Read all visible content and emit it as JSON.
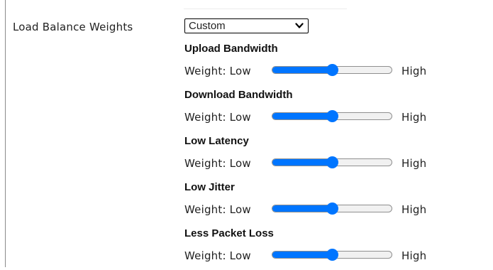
{
  "load_balance": {
    "label": "Load Balance Weights",
    "mode_select": {
      "value": "Custom"
    }
  },
  "accent_color": "#0075ff",
  "weights": [
    {
      "title": "Upload Bandwidth",
      "low_text": "Weight: Low",
      "high_text": "High",
      "level": 0.5
    },
    {
      "title": "Download Bandwidth",
      "low_text": "Weight: Low",
      "high_text": "High",
      "level": 0.5
    },
    {
      "title": "Low Latency",
      "low_text": "Weight: Low",
      "high_text": "High",
      "level": 0.5
    },
    {
      "title": "Low Jitter",
      "low_text": "Weight: Low",
      "high_text": "High",
      "level": 0.5
    },
    {
      "title": "Less Packet Loss",
      "low_text": "Weight: Low",
      "high_text": "High",
      "level": 0.5
    }
  ]
}
